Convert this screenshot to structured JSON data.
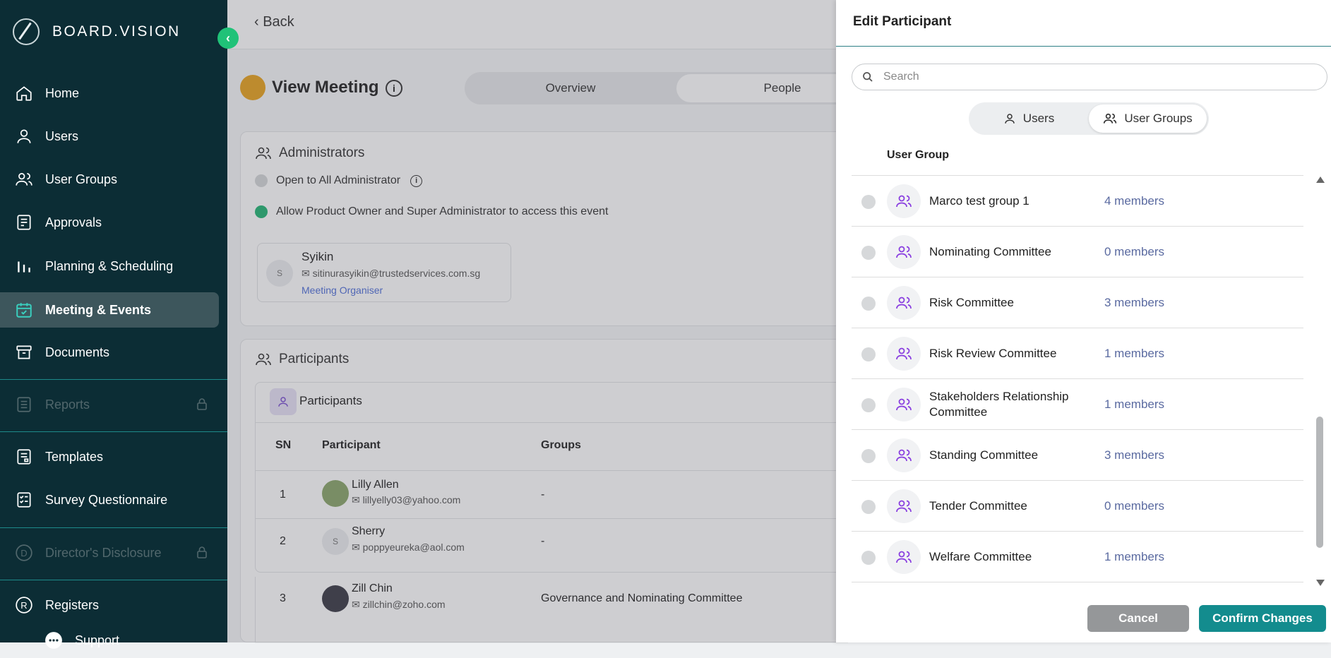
{
  "app": {
    "brand": "BOARD.VISION"
  },
  "sidebar": {
    "items": [
      {
        "label": "Home",
        "icon": "home-icon"
      },
      {
        "label": "Users",
        "icon": "user-icon"
      },
      {
        "label": "User Groups",
        "icon": "users-icon"
      },
      {
        "label": "Approvals",
        "icon": "approvals-icon"
      },
      {
        "label": "Planning & Scheduling",
        "icon": "bar-chart-icon"
      },
      {
        "label": "Meeting & Events",
        "icon": "calendar-check-icon"
      },
      {
        "label": "Documents",
        "icon": "archive-icon"
      },
      {
        "label": "Reports",
        "icon": "list-icon"
      },
      {
        "label": "Templates",
        "icon": "template-icon"
      },
      {
        "label": "Survey Questionnaire",
        "icon": "checklist-icon"
      },
      {
        "label": "Director's Disclosure",
        "icon": "d-circle-icon"
      },
      {
        "label": "Registers",
        "icon": "r-circle-icon"
      },
      {
        "label": "Support",
        "icon": "chat-icon"
      }
    ]
  },
  "main": {
    "back_label": "Back",
    "title": "View Meeting",
    "tabs": [
      {
        "label": "Overview"
      },
      {
        "label": "People"
      }
    ],
    "administrators": {
      "heading": "Administrators",
      "open_label": "Open to All Administrator",
      "allow_label": "Allow Product Owner and Super Administrator to access this event",
      "organiser": {
        "initial": "S",
        "name": "Syikin",
        "email": "sitinurasyikin@trustedservices.com.sg",
        "role": "Meeting Organiser"
      }
    },
    "participants": {
      "heading": "Participants",
      "sub_heading": "Participants",
      "columns": {
        "sn": "SN",
        "participant": "Participant",
        "groups": "Groups"
      },
      "rows": [
        {
          "sn": "1",
          "name": "Lilly Allen",
          "email": "lillyelly03@yahoo.com",
          "groups": "-"
        },
        {
          "sn": "2",
          "name": "Sherry",
          "email": "poppyeureka@aol.com",
          "groups": "-",
          "initial": "S"
        },
        {
          "sn": "3",
          "name": "Zill Chin",
          "email": "zillchin@zoho.com",
          "groups": "Governance and Nominating Committee"
        }
      ]
    }
  },
  "panel": {
    "title": "Edit Participant",
    "search_placeholder": "Search",
    "seg_users": "Users",
    "seg_groups": "User Groups",
    "column_label": "User Group",
    "groups": [
      {
        "name": "Marco test group 1",
        "count": "4 members"
      },
      {
        "name": "Nominating Committee",
        "count": "0 members"
      },
      {
        "name": "Risk Committee",
        "count": "3 members"
      },
      {
        "name": "Risk Review Committee",
        "count": "1 members"
      },
      {
        "name": "Stakeholders Relationship Committee",
        "count": "1 members"
      },
      {
        "name": "Standing Committee",
        "count": "3 members"
      },
      {
        "name": "Tender Committee",
        "count": "0 members"
      },
      {
        "name": "Welfare Committee",
        "count": "1 members"
      }
    ],
    "cancel_label": "Cancel",
    "confirm_label": "Confirm Changes"
  }
}
